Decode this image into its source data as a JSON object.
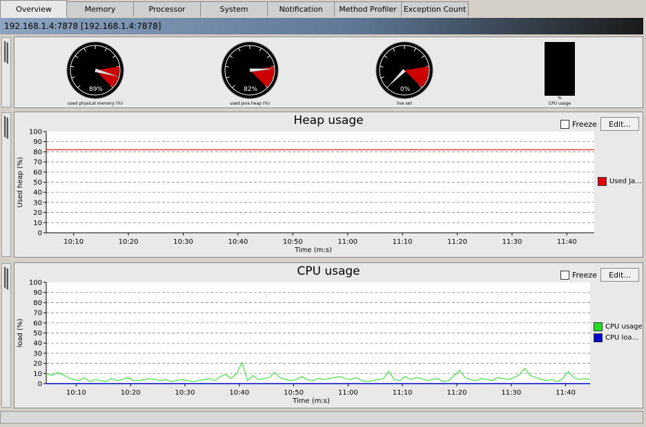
{
  "tabs": [
    {
      "label": "Overview",
      "active": true
    },
    {
      "label": "Memory",
      "active": false
    },
    {
      "label": "Processor",
      "active": false
    },
    {
      "label": "System",
      "active": false
    },
    {
      "label": "Notification",
      "active": false
    },
    {
      "label": "Method Profiler",
      "active": false
    },
    {
      "label": "Exception Count",
      "active": false
    }
  ],
  "connection_title": "192.168.1.4:7878 [192.168.1.4:7878]",
  "overview": {
    "gauges": [
      {
        "label": "used physical memory (%)",
        "value_text": "89%",
        "value": 89
      },
      {
        "label": "used Java heap (%)",
        "value_text": "82%",
        "value": 82
      },
      {
        "label": "live set",
        "value_text": "0%",
        "value": 0
      }
    ],
    "cpu_meter": {
      "label": "CPU usage",
      "value_text": "%"
    }
  },
  "heap_chart": {
    "freeze_label": "Freeze",
    "edit_label": "Edit...",
    "legend": [
      {
        "name": "Used Ja...",
        "color": "#e00000"
      }
    ]
  },
  "cpu_chart": {
    "freeze_label": "Freeze",
    "edit_label": "Edit...",
    "legend": [
      {
        "name": "CPU usage",
        "color": "#22dd22"
      },
      {
        "name": "CPU loa...",
        "color": "#0000cc"
      }
    ]
  },
  "chart_data": [
    {
      "type": "line",
      "title": "Heap usage",
      "xlabel": "Time  (m:s)",
      "ylabel": "Used heap (%)",
      "ylim": [
        0,
        100
      ],
      "yticks": [
        0,
        10,
        20,
        30,
        40,
        50,
        60,
        70,
        80,
        90,
        100
      ],
      "xticks": [
        "10:10",
        "10:20",
        "10:30",
        "10:40",
        "10:50",
        "11:00",
        "11:10",
        "11:20",
        "11:30",
        "11:40"
      ],
      "xlim": [
        0,
        100
      ],
      "xtick_positions": [
        5,
        15,
        25,
        35,
        45,
        55,
        65,
        75,
        85,
        95
      ],
      "grid": true,
      "series": [
        {
          "name": "Used Ja...",
          "color": "#e00000",
          "x": [
            0,
            100
          ],
          "y": [
            82,
            82
          ]
        }
      ]
    },
    {
      "type": "line",
      "title": "CPU usage",
      "xlabel": "Time  (m:s)",
      "ylabel": "load (%)",
      "ylim": [
        0,
        100
      ],
      "yticks": [
        0,
        10,
        20,
        30,
        40,
        50,
        60,
        70,
        80,
        90,
        100
      ],
      "xticks": [
        "10:10",
        "10:20",
        "10:30",
        "10:40",
        "10:50",
        "11:00",
        "11:10",
        "11:20",
        "11:30",
        "11:40"
      ],
      "xlim": [
        0,
        100
      ],
      "xtick_positions": [
        5.5,
        15.5,
        25.5,
        35.5,
        45.5,
        55.5,
        65.5,
        75.5,
        85.5,
        95.5
      ],
      "grid": true,
      "series": [
        {
          "name": "CPU usage",
          "color": "#22dd22",
          "x": [
            0,
            1,
            2,
            3,
            4,
            5,
            6,
            7,
            8,
            9,
            10,
            11,
            12,
            13,
            14,
            15,
            16,
            17,
            18,
            19,
            20,
            21,
            22,
            23,
            24,
            25,
            26,
            27,
            28,
            29,
            30,
            31,
            32,
            33,
            34,
            35,
            36,
            37,
            38,
            39,
            40,
            41,
            42,
            43,
            44,
            45,
            46,
            47,
            48,
            49,
            50,
            51,
            52,
            53,
            54,
            55,
            56,
            57,
            58,
            59,
            60,
            61,
            62,
            63,
            64,
            65,
            66,
            67,
            68,
            69,
            70,
            71,
            72,
            73,
            74,
            75,
            76,
            77,
            78,
            79,
            80,
            81,
            82,
            83,
            84,
            85,
            86,
            87,
            88,
            89,
            90,
            91,
            92,
            93,
            94,
            95,
            96,
            97,
            98,
            99,
            100
          ],
          "y": [
            10,
            8,
            11,
            9,
            6,
            4,
            3,
            6,
            2,
            4,
            3,
            2,
            5,
            3,
            4,
            6,
            3,
            3,
            4,
            5,
            4,
            3,
            4,
            2,
            3,
            4,
            3,
            2,
            3,
            4,
            5,
            3,
            7,
            9,
            5,
            10,
            21,
            3,
            8,
            4,
            5,
            6,
            11,
            6,
            4,
            3,
            4,
            7,
            4,
            3,
            5,
            4,
            5,
            6,
            7,
            5,
            4,
            6,
            3,
            2,
            3,
            4,
            5,
            12,
            4,
            3,
            7,
            4,
            6,
            5,
            3,
            4,
            5,
            2,
            3,
            8,
            13,
            6,
            4,
            3,
            5,
            4,
            3,
            6,
            5,
            4,
            6,
            9,
            15,
            8,
            6,
            4,
            3,
            4,
            2,
            5,
            12,
            6,
            4,
            5,
            4
          ]
        },
        {
          "name": "CPU loa...",
          "color": "#0000cc",
          "x": [
            0,
            100
          ],
          "y": [
            0,
            0
          ]
        }
      ]
    }
  ]
}
